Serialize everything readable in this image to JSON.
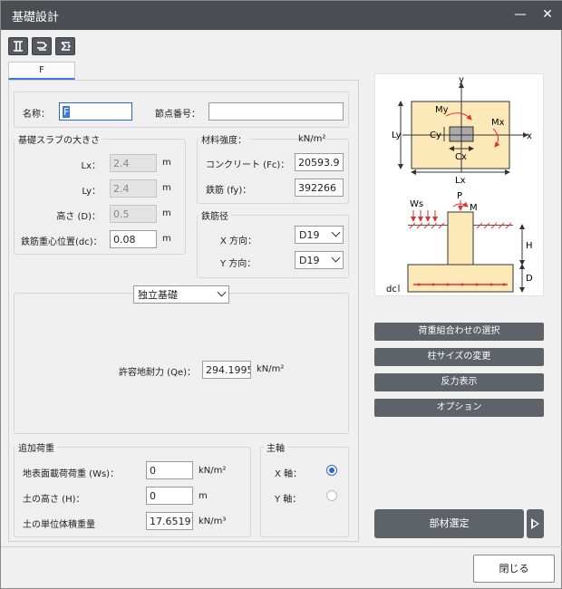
{
  "window": {
    "title": "基礎設計",
    "minimize_glyph": "—",
    "close_glyph": "✕"
  },
  "toolbar": {
    "icons": [
      "tool-icon-1",
      "tool-icon-2",
      "tool-icon-3"
    ]
  },
  "tab": {
    "label": "F"
  },
  "name_row": {
    "name_label": "名称：",
    "name_value": "F",
    "node_label": "節点番号：",
    "node_value": ""
  },
  "slab": {
    "title": "基礎スラブの大きさ",
    "lx_label": "Lx：",
    "lx_value": "2.4",
    "lx_unit": "m",
    "ly_label": "Ly：",
    "ly_value": "2.4",
    "ly_unit": "m",
    "d_label": "高さ (D)：",
    "d_value": "0.5",
    "d_unit": "m",
    "dc_label": "鉄筋重心位置(dc)：",
    "dc_value": "0.08",
    "dc_unit": "m"
  },
  "material": {
    "title": "材料強度：",
    "unit": "kN/m²",
    "fc_label": "コンクリート (Fc)：",
    "fc_value": "20593.9",
    "fy_label": "鉄筋 (fy)：",
    "fy_value": "392266"
  },
  "rebar": {
    "title": "鉄筋径",
    "x_label": "X 方向：",
    "x_value": "D19",
    "y_label": "Y 方向：",
    "y_value": "D19"
  },
  "foundation": {
    "type_value": "独立基礎",
    "qe_label": "許容地耐力 (Qe)：",
    "qe_value": "294.1995",
    "qe_unit": "kN/m²"
  },
  "additional_load": {
    "title": "追加荷重",
    "ws_label": "地表面載荷荷重 (Ws)：",
    "ws_value": "0",
    "ws_unit": "kN/m²",
    "h_label": "土の高さ (H)：",
    "h_value": "0",
    "h_unit": "m",
    "gamma_label": "土の単位体積重量",
    "gamma_value": "17.65197",
    "gamma_unit": "kN/m³"
  },
  "axis": {
    "title": "主軸",
    "x_label": "X 軸：",
    "y_label": "Y 軸：",
    "selected": "X"
  },
  "diagram_labels": {
    "y": "y",
    "x": "x",
    "my": "My",
    "mx": "Mx",
    "ly": "Ly",
    "cy": "Cy",
    "cx": "Cx",
    "lx": "Lx",
    "ws": "Ws",
    "p": "P",
    "m": "M",
    "h": "H",
    "d": "D",
    "dc": "dc"
  },
  "actions": {
    "load_combo": "荷重組合わせの選択",
    "column_size": "柱サイズの変更",
    "reaction": "反力表示",
    "options": "オプション",
    "member_select": "部材選定",
    "close": "閉じる"
  }
}
